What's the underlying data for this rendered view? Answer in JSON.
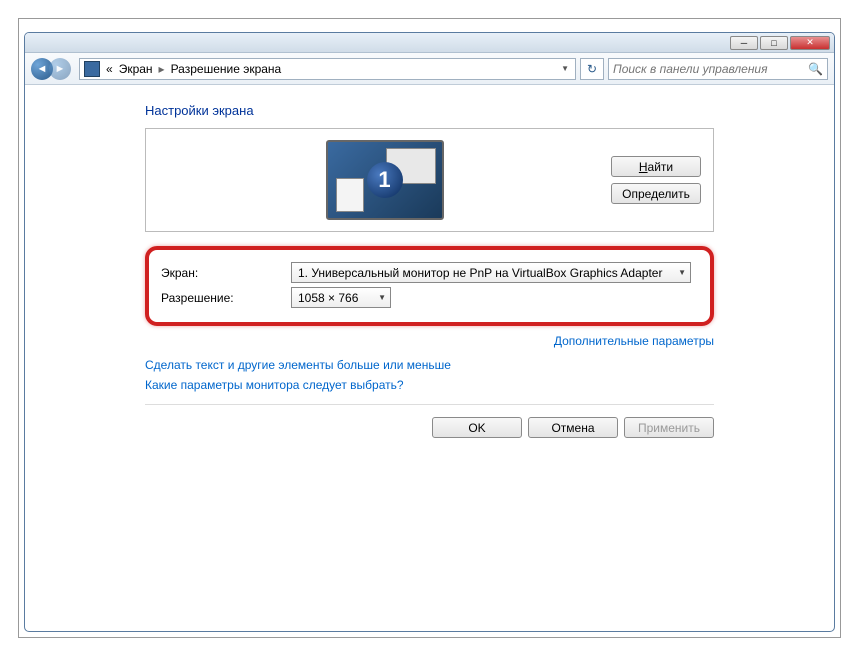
{
  "titlebar": {},
  "breadcrumb": {
    "prefix": "«",
    "level1": "Экран",
    "level2": "Разрешение экрана"
  },
  "search": {
    "placeholder": "Поиск в панели управления"
  },
  "heading": "Настройки экрана",
  "preview": {
    "monitor_number": "1",
    "find_label": "Найти",
    "detect_label": "Определить"
  },
  "fields": {
    "display_label": "Экран:",
    "display_value": "1. Универсальный монитор не PnP на VirtualBox Graphics Adapter",
    "resolution_label": "Разрешение:",
    "resolution_value": "1058 × 766"
  },
  "links": {
    "advanced": "Дополнительные параметры",
    "text_size": "Сделать текст и другие элементы больше или меньше",
    "which_settings": "Какие параметры монитора следует выбрать?"
  },
  "buttons": {
    "ok": "OK",
    "cancel": "Отмена",
    "apply": "Применить"
  }
}
